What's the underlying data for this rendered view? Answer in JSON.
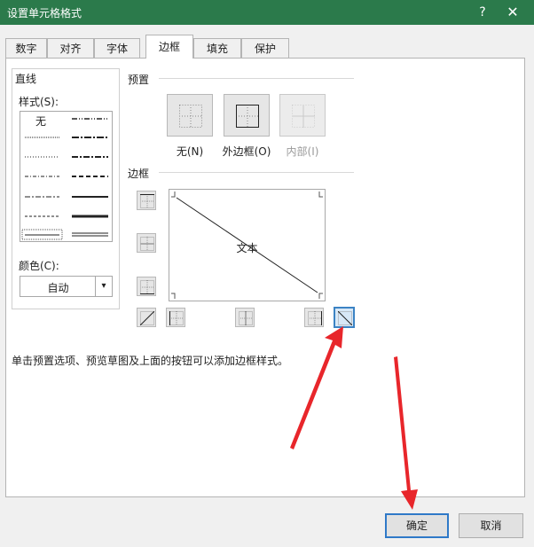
{
  "window": {
    "title": "设置单元格格式",
    "help_glyph": "?",
    "close_glyph": "✕"
  },
  "tabs": [
    {
      "label": "数字",
      "active": false
    },
    {
      "label": "对齐",
      "active": false
    },
    {
      "label": "字体",
      "active": false
    },
    {
      "label": "边框",
      "active": true
    },
    {
      "label": "填充",
      "active": false
    },
    {
      "label": "保护",
      "active": false
    }
  ],
  "line": {
    "group_label": "直线",
    "style_label": "样式(S):",
    "none_label": "无",
    "color_label": "颜色(C):",
    "color_value": "自动"
  },
  "presets": {
    "label": "预置",
    "items": [
      {
        "label": "无(N)",
        "disabled": false
      },
      {
        "label": "外边框(O)",
        "disabled": false
      },
      {
        "label": "内部(I)",
        "disabled": true
      }
    ]
  },
  "border": {
    "label": "边框",
    "preview_text": "文本"
  },
  "hint": "单击预置选项、预览草图及上面的按钮可以添加边框样式。",
  "buttons": {
    "ok": "确定",
    "cancel": "取消"
  },
  "colors": {
    "titlebar": "#2b7a4b",
    "annotation_arrow": "#e8262b",
    "selected": "#3b83c4"
  }
}
